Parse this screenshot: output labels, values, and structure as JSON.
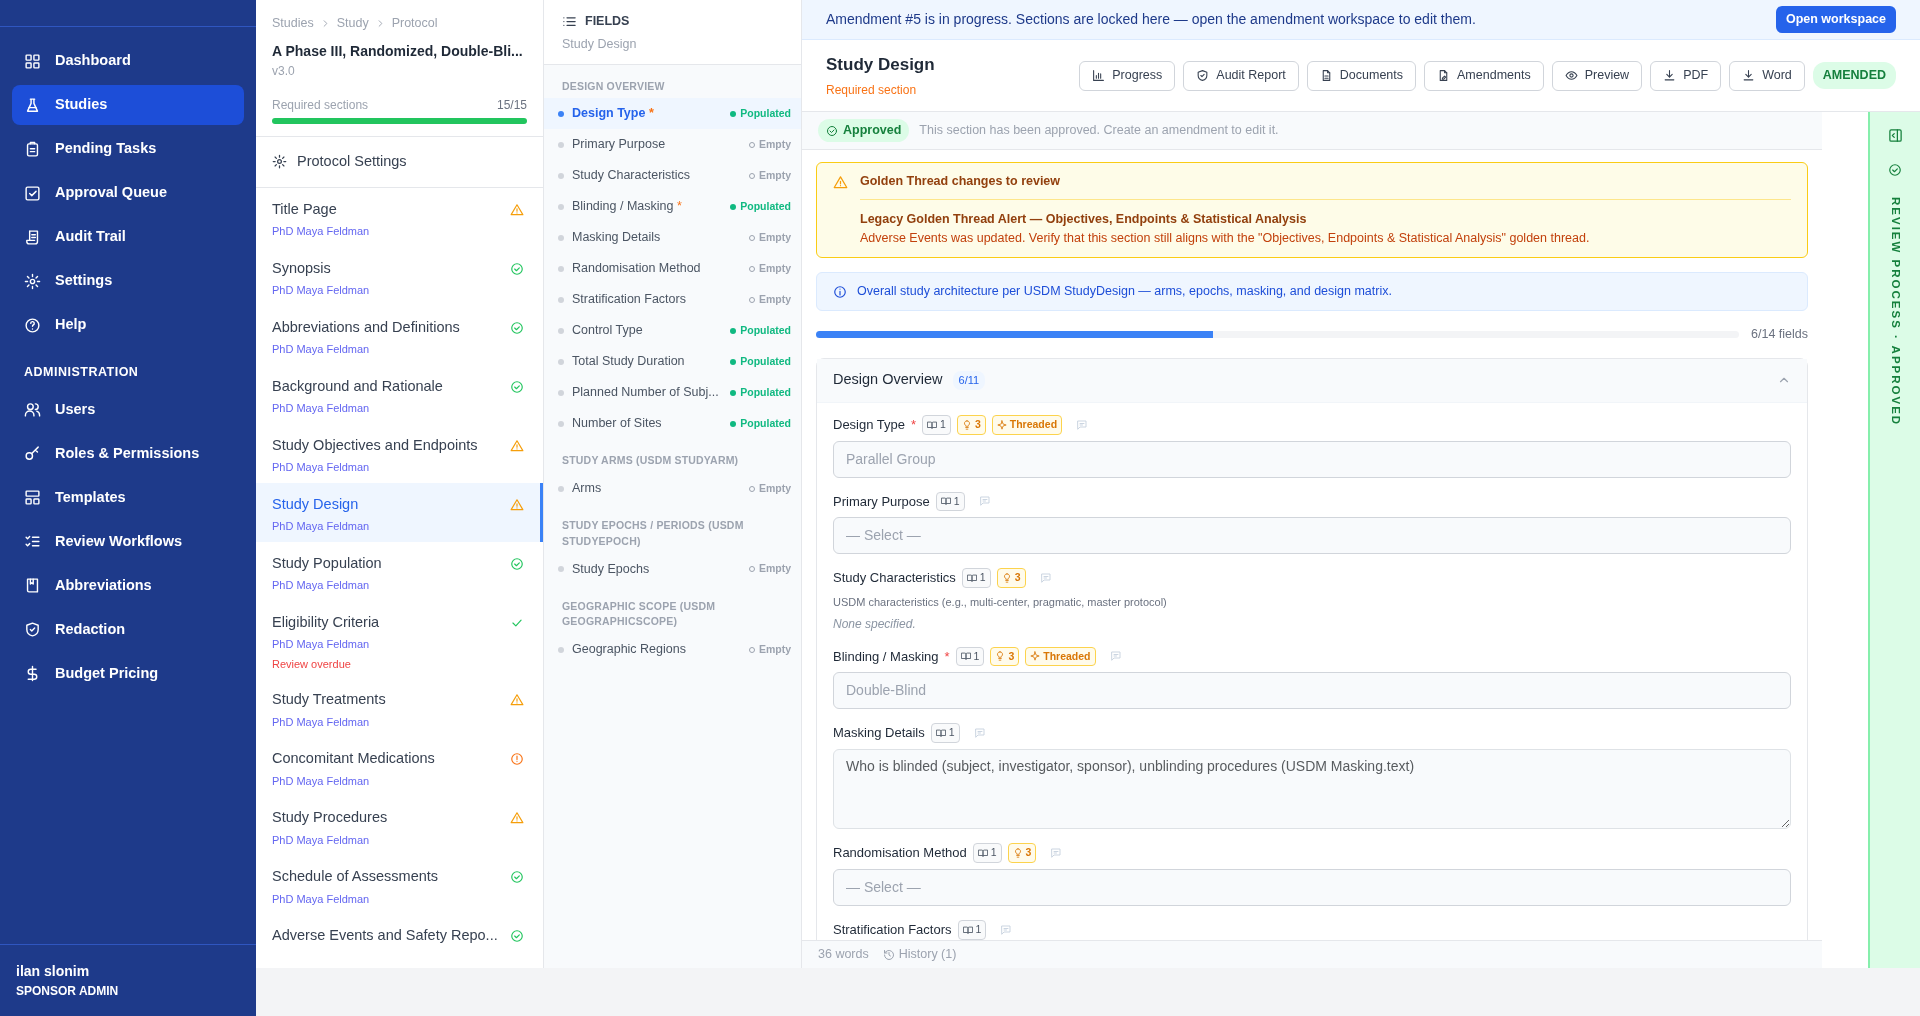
{
  "sidebar": {
    "nav": [
      {
        "label": "Dashboard",
        "selected": false
      },
      {
        "label": "Studies",
        "selected": true
      },
      {
        "label": "Pending Tasks",
        "selected": false
      },
      {
        "label": "Approval Queue",
        "selected": false
      },
      {
        "label": "Audit Trail",
        "selected": false
      },
      {
        "label": "Settings",
        "selected": false
      },
      {
        "label": "Help",
        "selected": false
      }
    ],
    "admin_heading": "ADMINISTRATION",
    "admin": [
      {
        "label": "Users",
        "selected": false
      },
      {
        "label": "Roles & Permissions",
        "selected": false
      },
      {
        "label": "Templates",
        "selected": false
      },
      {
        "label": "Review Workflows",
        "selected": false
      },
      {
        "label": "Abbreviations",
        "selected": false
      },
      {
        "label": "Redaction",
        "selected": false
      },
      {
        "label": "Budget Pricing",
        "selected": false
      }
    ],
    "user": {
      "name": "ilan slonim",
      "role": "SPONSOR ADMIN"
    }
  },
  "protocol": {
    "breadcrumb": [
      "Studies",
      "Study",
      "Protocol"
    ],
    "title": "A Phase III, Randomized, Double-Bli...",
    "version": "v3.0",
    "required": {
      "label": "Required sections",
      "count": "15/15",
      "level": 1
    },
    "settings_label": "Protocol Settings",
    "sections": [
      {
        "title": "Title Page",
        "author": "PhD Maya Feldman",
        "kind": "warning",
        "selected": false
      },
      {
        "title": "Synopsis",
        "author": "PhD Maya Feldman",
        "kind": "approved",
        "selected": false
      },
      {
        "title": "Abbreviations and Definitions",
        "author": "PhD Maya Feldman",
        "kind": "approved",
        "selected": false
      },
      {
        "title": "Background and Rationale",
        "author": "PhD Maya Feldman",
        "kind": "approved",
        "selected": false
      },
      {
        "title": "Study Objectives and Endpoints",
        "author": "PhD Maya Feldman",
        "kind": "warning",
        "selected": false
      },
      {
        "title": "Study Design",
        "author": "PhD Maya Feldman",
        "kind": "warning",
        "selected": true
      },
      {
        "title": "Study Population",
        "author": "PhD Maya Feldman",
        "kind": "approved",
        "selected": false
      },
      {
        "title": "Eligibility Criteria",
        "author": "PhD Maya Feldman",
        "kind": "done",
        "selected": false,
        "note": "Review overdue"
      },
      {
        "title": "Study Treatments",
        "author": "PhD Maya Feldman",
        "kind": "warning",
        "selected": false
      },
      {
        "title": "Concomitant Medications",
        "author": "PhD Maya Feldman",
        "kind": "issue",
        "selected": false
      },
      {
        "title": "Study Procedures",
        "author": "PhD Maya Feldman",
        "kind": "warning",
        "selected": false
      },
      {
        "title": "Schedule of Assessments",
        "author": "PhD Maya Feldman",
        "kind": "approved",
        "selected": false
      },
      {
        "title": "Adverse Events and Safety Repo...",
        "kind": "approved",
        "selected": false
      }
    ]
  },
  "fields_panel": {
    "title": "FIELDS",
    "subtitle": "Study Design",
    "groups": [
      {
        "heading": "DESIGN OVERVIEW",
        "items": [
          {
            "label": "Design Type",
            "required_mark": "*",
            "status": "Populated",
            "populated": true,
            "selected": true
          },
          {
            "label": "Primary Purpose",
            "status": "Empty",
            "populated": false,
            "selected": false
          },
          {
            "label": "Study Characteristics",
            "status": "Empty",
            "populated": false,
            "selected": false
          },
          {
            "label": "Blinding / Masking",
            "required_mark": "*",
            "status": "Populated",
            "populated": true,
            "selected": false
          },
          {
            "label": "Masking Details",
            "status": "Empty",
            "populated": false,
            "selected": false
          },
          {
            "label": "Randomisation Method",
            "status": "Empty",
            "populated": false,
            "selected": false
          },
          {
            "label": "Stratification Factors",
            "status": "Empty",
            "populated": false,
            "selected": false
          },
          {
            "label": "Control Type",
            "status": "Populated",
            "populated": true,
            "selected": false
          },
          {
            "label": "Total Study Duration",
            "status": "Populated",
            "populated": true,
            "selected": false
          },
          {
            "label": "Planned Number of Subj...",
            "status": "Populated",
            "populated": true,
            "selected": false
          },
          {
            "label": "Number of Sites",
            "status": "Populated",
            "populated": true,
            "selected": false
          }
        ]
      },
      {
        "heading": "STUDY ARMS (USDM STUDYARM)",
        "items": [
          {
            "label": "Arms",
            "status": "Empty",
            "populated": false,
            "selected": false
          }
        ]
      },
      {
        "heading": "STUDY EPOCHS / PERIODS (USDM STUDYEPOCH)",
        "items": [
          {
            "label": "Study Epochs",
            "status": "Empty",
            "populated": false,
            "selected": false
          }
        ]
      },
      {
        "heading": "GEOGRAPHIC SCOPE (USDM GEOGRAPHICSCOPE)",
        "items": [
          {
            "label": "Geographic Regions",
            "status": "Empty",
            "populated": false,
            "selected": false
          }
        ]
      }
    ]
  },
  "banner": {
    "text": "Amendment #5 is in progress. Sections are locked here — open the amendment workspace to edit them.",
    "button": "Open workspace"
  },
  "header": {
    "title": "Study Design",
    "subtitle": "Required section",
    "buttons": [
      "Progress",
      "Audit Report",
      "Documents",
      "Amendments",
      "Preview",
      "PDF",
      "Word"
    ],
    "status_badge": "AMENDED"
  },
  "approval": {
    "badge": "Approved",
    "text": "This section has been approved. Create an amendment to edit it."
  },
  "alert": {
    "title": "Golden Thread changes to review",
    "subtitle": "Legacy Golden Thread Alert — Objectives, Endpoints & Statistical Analysis",
    "body": "Adverse Events was updated. Verify that this section still aligns with the \"Objectives, Endpoints & Statistical Analysis\" golden thread."
  },
  "info": {
    "text": "Overall study architecture per USDM StudyDesign — arms, epochs, masking, and design matrix."
  },
  "progress": {
    "level": 0.43,
    "reading": "6/14 fields"
  },
  "card": {
    "title": "Design Overview",
    "count": "6/11",
    "expanded": true,
    "fields": [
      {
        "kind": "select",
        "label": "Design Type",
        "required_mark": "*",
        "refs": "1",
        "hints": "3",
        "threaded": "Threaded",
        "value": "Parallel Group"
      },
      {
        "kind": "select",
        "label": "Primary Purpose",
        "refs": "1",
        "value": "— Select —"
      },
      {
        "kind": "static",
        "label": "Study Characteristics",
        "refs": "1",
        "hints": "3",
        "help": "USDM characteristics (e.g., multi-center, pragmatic, master protocol)",
        "value": "None specified."
      },
      {
        "kind": "select",
        "label": "Blinding / Masking",
        "required_mark": "*",
        "refs": "1",
        "hints": "3",
        "threaded": "Threaded",
        "value": "Double-Blind"
      },
      {
        "kind": "textarea",
        "label": "Masking Details",
        "refs": "1",
        "placeholder": "Who is blinded (subject, investigator, sponsor), unblinding procedures (USDM Masking.text)"
      },
      {
        "kind": "select",
        "label": "Randomisation Method",
        "refs": "1",
        "hints": "3",
        "value": "— Select —"
      },
      {
        "kind": "select",
        "label": "Stratification Factors",
        "refs": "1"
      }
    ]
  },
  "footer": {
    "words": "36 words",
    "history": "History (1)"
  },
  "review_rail": {
    "text": "REVIEW PROCESS · APPROVED"
  }
}
